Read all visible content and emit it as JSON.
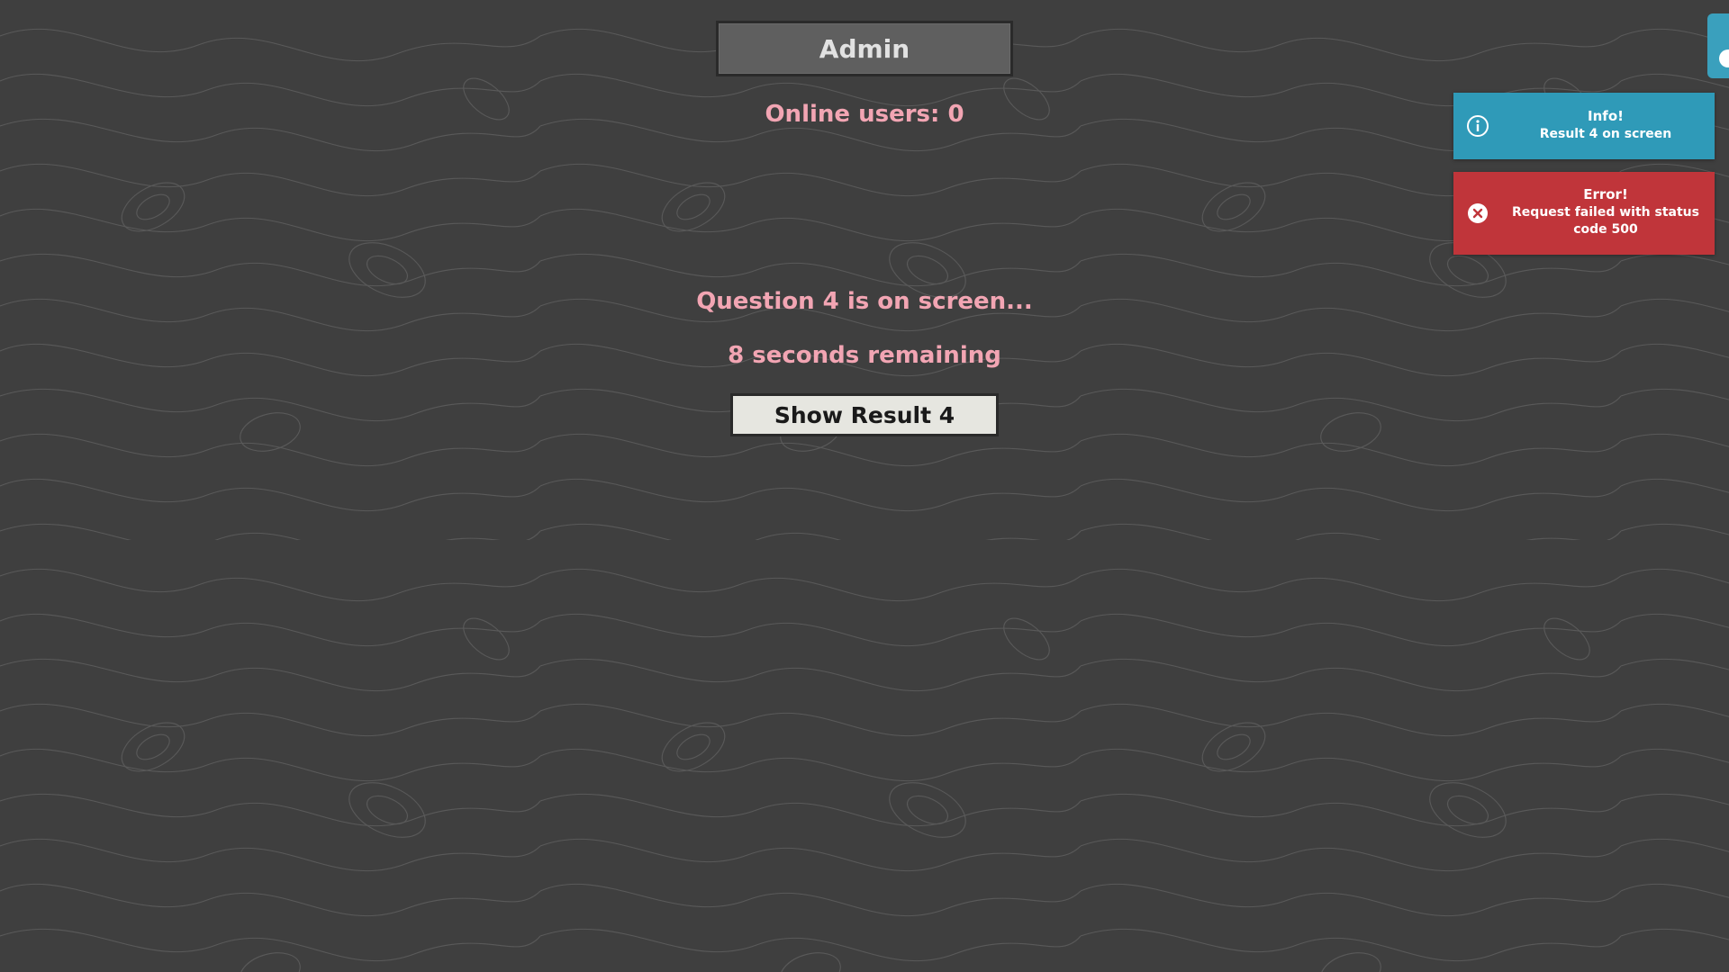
{
  "header": {
    "title": "Admin"
  },
  "status": {
    "online_users": "Online users: 0",
    "question": "Question 4 is on screen...",
    "remaining": "8 seconds remaining"
  },
  "controls": {
    "show_result_label": "Show Result 4"
  },
  "notifications": [
    {
      "type": "info",
      "icon": "info-icon",
      "title": "Info!",
      "message": "Result 4 on screen",
      "color": "#2f9ab8"
    },
    {
      "type": "error",
      "icon": "close-circle-icon",
      "title": "Error!",
      "message": "Request failed with status code 500",
      "color": "#c0353a"
    }
  ],
  "theme": {
    "background": "#3f3f3f",
    "accent_text": "#f2a5b3",
    "button_background": "#e6e6e0",
    "header_background": "#5f5f5f"
  }
}
